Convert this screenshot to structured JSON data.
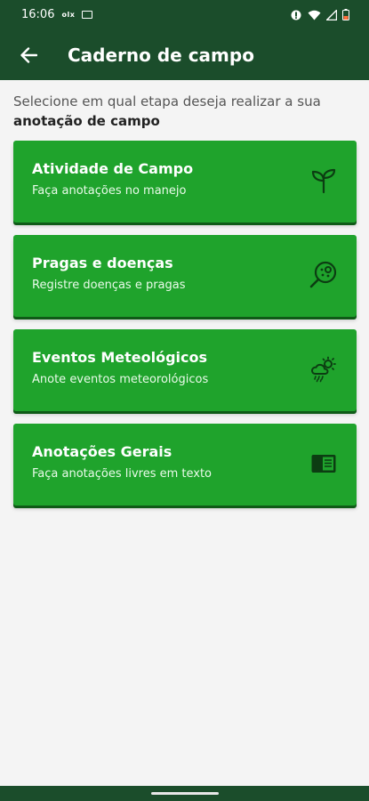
{
  "status_bar": {
    "time": "16:06",
    "indicator_text": "olx",
    "icons": [
      "eye-icon",
      "wifi-icon",
      "signal-icon",
      "battery-icon"
    ]
  },
  "app_bar": {
    "title": "Caderno de campo",
    "back_icon": "arrow-left-icon"
  },
  "intro": {
    "text": "Selecione em qual etapa deseja realizar a sua ",
    "bold": "anotação de campo"
  },
  "cards": [
    {
      "title": "Atividade de Campo",
      "subtitle": "Faça anotações no manejo",
      "icon": "sprout-icon"
    },
    {
      "title": "Pragas e doenças",
      "subtitle": "Registre doenças e pragas",
      "icon": "pest-search-icon"
    },
    {
      "title": "Eventos Meteológicos",
      "subtitle": "Anote eventos meteorológicos",
      "icon": "weather-icon"
    },
    {
      "title": "Anotações Gerais",
      "subtitle": "Faça anotações livres em texto",
      "icon": "notebook-icon"
    }
  ],
  "colors": {
    "header": "#1b4d2b",
    "card": "#1fa32c",
    "background": "#f4f4f4"
  }
}
